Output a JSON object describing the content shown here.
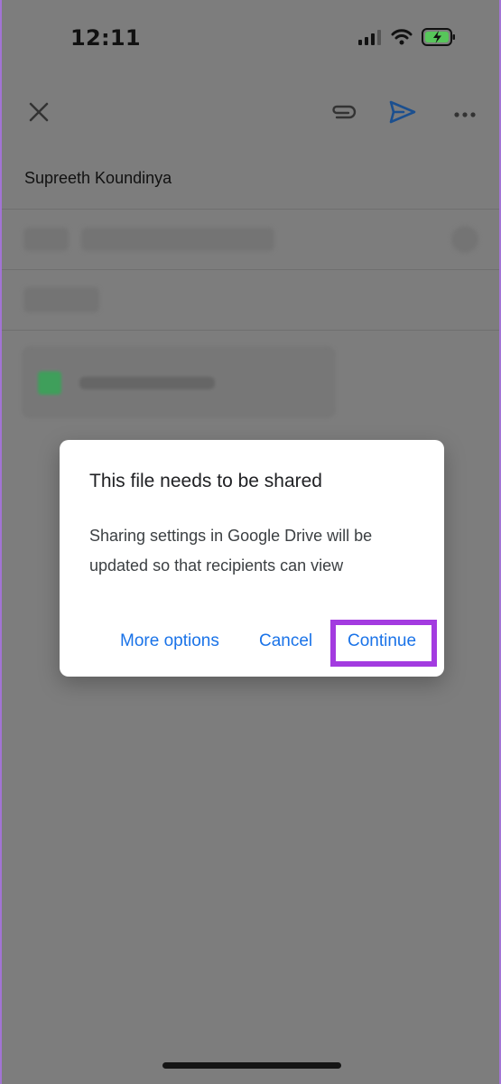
{
  "status_bar": {
    "time": "12:11",
    "icons": [
      "cellular-signal-icon",
      "wifi-icon",
      "battery-charging-icon"
    ]
  },
  "toolbar": {
    "close_icon": "close-icon",
    "attach_icon": "paperclip-icon",
    "send_icon": "send-icon",
    "more_icon": "more-horizontal-icon"
  },
  "compose": {
    "from": "Supreeth Koundinya"
  },
  "dialog": {
    "title": "This file needs to be shared",
    "body": "Sharing settings in Google Drive will be updated so that recipients can view",
    "actions": {
      "more_options": "More options",
      "cancel": "Cancel",
      "continue": "Continue"
    }
  },
  "colors": {
    "accent": "#1a73e8",
    "highlight": "#a33be0",
    "overlay": "#7d7d7d",
    "attachment_green": "#3f9f5b"
  }
}
